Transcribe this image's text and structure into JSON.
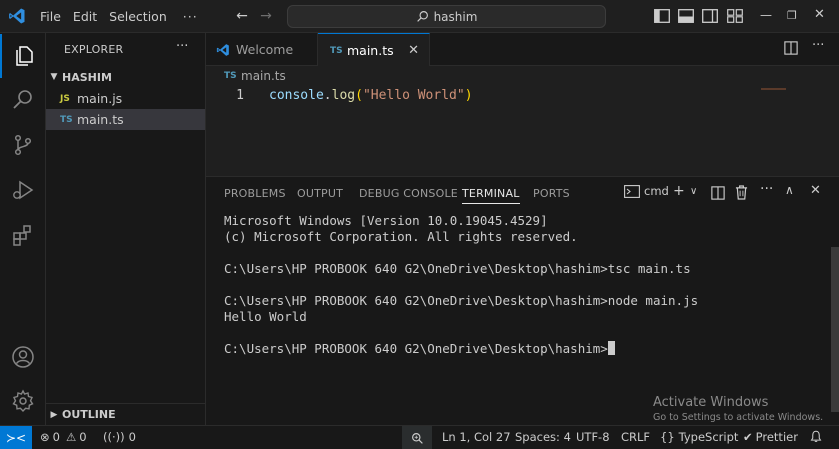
{
  "menu": {
    "file": "File",
    "edit": "Edit",
    "selection": "Selection",
    "more": "···"
  },
  "search": {
    "text": "hashim"
  },
  "explorer": {
    "title": "EXPLORER",
    "more": "···",
    "folder": "HASHIM",
    "files": [
      {
        "icon": "JS",
        "name": "main.js"
      },
      {
        "icon": "TS",
        "name": "main.ts"
      }
    ],
    "outline": "OUTLINE"
  },
  "tabs": {
    "welcome": "Welcome",
    "main_icon": "TS",
    "main": "main.ts"
  },
  "editor": {
    "breadcrumb_icon": "TS",
    "breadcrumb": "main.ts",
    "line_number": "1",
    "code": {
      "obj": "console",
      "dot": ".",
      "fn": "log",
      "open": "(",
      "str": "\"Hello World\"",
      "close": ")"
    }
  },
  "panel": {
    "tabs": {
      "problems": "PROBLEMS",
      "output": "OUTPUT",
      "debug": "DEBUG CONSOLE",
      "terminal": "TERMINAL",
      "ports": "PORTS"
    },
    "shell": "cmd",
    "terminal_lines": {
      "l1": "Microsoft Windows [Version 10.0.19045.4529]",
      "l2": "(c) Microsoft Corporation. All rights reserved.",
      "l3": "C:\\Users\\HP PROBOOK 640 G2\\OneDrive\\Desktop\\hashim>tsc main.ts",
      "l4": "C:\\Users\\HP PROBOOK 640 G2\\OneDrive\\Desktop\\hashim>node main.js",
      "l5": "Hello World",
      "l6": "C:\\Users\\HP PROBOOK 640 G2\\OneDrive\\Desktop\\hashim>"
    }
  },
  "watermark": {
    "title": "Activate Windows",
    "subtitle": "Go to Settings to activate Windows."
  },
  "status": {
    "errors": "0",
    "warnings": "0",
    "ports": "0",
    "position": "Ln 1, Col 27",
    "spaces": "Spaces: 4",
    "encoding": "UTF-8",
    "eol": "CRLF",
    "language": "TypeScript",
    "formatter": "Prettier"
  },
  "colors": {
    "accent": "#0078d4",
    "background": "#1f1f1f",
    "sidebar": "#181818"
  }
}
